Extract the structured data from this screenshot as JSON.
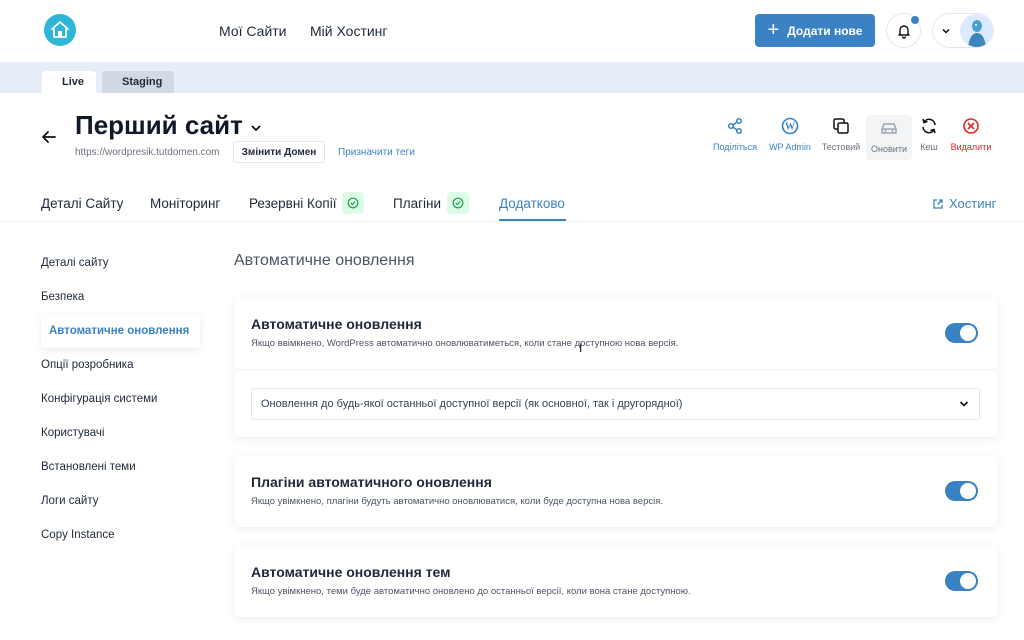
{
  "topnav": {
    "links": [
      "Мої Сайти",
      "Мій Хостинг"
    ],
    "add_label": "Додати нове"
  },
  "env": {
    "live": "Live",
    "staging": "Staging",
    "live_color": "#22c55e",
    "staging_color": "#2563eb"
  },
  "site": {
    "title": "Перший сайт",
    "url": "https://wordpresik.tutdomen.com",
    "change_domain": "Змінити Домен",
    "assign_tags": "Призначити теги"
  },
  "actions": {
    "share": "Поділіться",
    "wp_admin": "WP Admin",
    "test": "Тестовий",
    "update": "Оновити",
    "cache": "Кеш",
    "delete": "Видалити"
  },
  "tabs": {
    "details": "Деталі Сайту",
    "monitoring": "Моніторинг",
    "backups": "Резервні Копії",
    "plugins": "Плагіни",
    "extra": "Додатково",
    "hosting": "Хостинг"
  },
  "sidebar": {
    "items": [
      "Деталі сайту",
      "Безпека",
      "Автоматичне оновлення",
      "Опції розробника",
      "Конфігурація системи",
      "Користувачі",
      "Встановлені теми",
      "Логи сайту",
      "Copy Instance"
    ],
    "active_index": 2
  },
  "content": {
    "section_title": "Автоматичне оновлення",
    "cards": [
      {
        "title": "Автоматичне оновлення",
        "desc": "Якщо ввімкнено, WordPress автоматично оновлюватиметься, коли стане доступною нова версія.",
        "enabled": true,
        "select_value": "Оновлення до будь-якої останньої доступної версії (як основної, так і другорядної)"
      },
      {
        "title": "Плагіни автоматичного оновлення",
        "desc": "Якщо увімкнено, плагіни будуть автоматично оновлюватися, коли буде доступна нова версія.",
        "enabled": true
      },
      {
        "title": "Автоматичне оновлення тем",
        "desc": "Якщо увімкнено, теми буде автоматично оновлено до останньої версії, коли вона стане доступною.",
        "enabled": true
      }
    ]
  },
  "colors": {
    "accent": "#3b82c4",
    "danger": "#dc2626",
    "success": "#22c55e"
  }
}
